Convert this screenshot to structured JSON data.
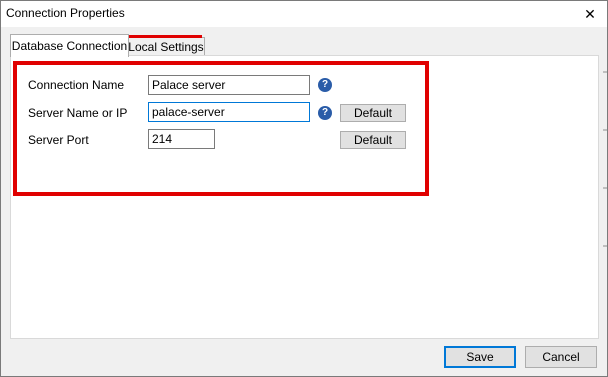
{
  "window": {
    "title": "Connection Properties",
    "close_glyph": "✕"
  },
  "tabs": [
    {
      "label": "Database Connection",
      "active": true
    },
    {
      "label": "Local Settings",
      "active": false
    }
  ],
  "form": {
    "connection_name": {
      "label": "Connection Name",
      "value": "Palace server"
    },
    "server_name": {
      "label": "Server Name or IP",
      "value": "palace-server"
    },
    "server_port": {
      "label": "Server Port",
      "value": "214"
    },
    "default_label": "Default",
    "help_glyph": "?"
  },
  "footer": {
    "save_label": "Save",
    "cancel_label": "Cancel"
  },
  "colors": {
    "highlight": "#e00000",
    "help_icon": "#2a5ca8",
    "focus": "#0078d7"
  }
}
